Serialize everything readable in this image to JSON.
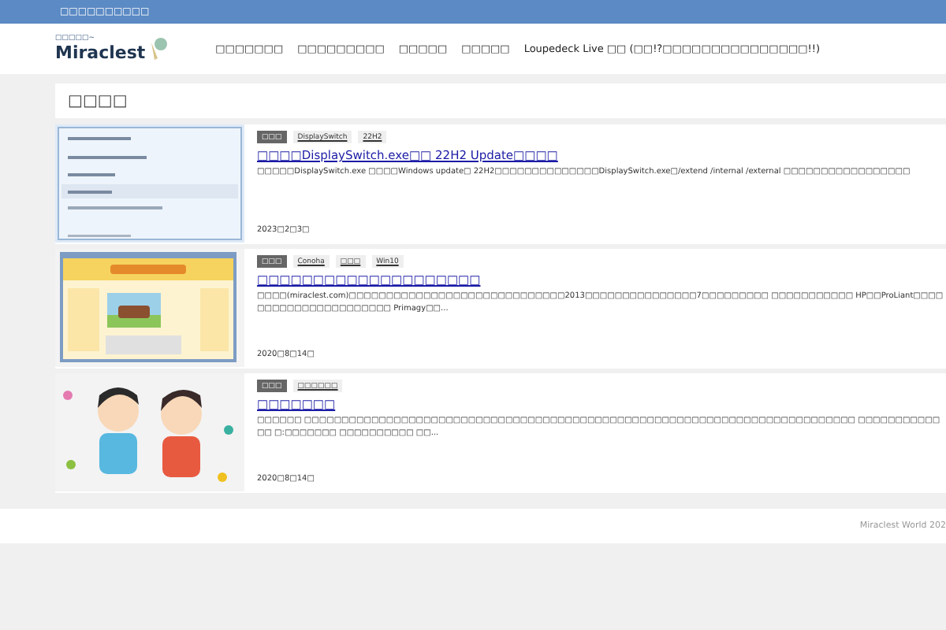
{
  "top_bar": {
    "text": "□□□□□□□□□□"
  },
  "logo": {
    "tagline": "□□□□□~",
    "name": "Miraclest"
  },
  "nav": [
    "□□□□□□□",
    "□□□□□□□□□",
    "□□□□□",
    "□□□□□",
    "Loupedeck Live □□ (□□!?□□□□□□□□□□□□□□□!!)"
  ],
  "section_title": "□□□□",
  "posts": [
    {
      "thumbnail": {
        "kind": "picture"
      },
      "tags": [
        {
          "label": "□□□",
          "kind": "category"
        },
        {
          "label": "DisplaySwitch",
          "kind": "tag"
        },
        {
          "label": "22H2",
          "kind": "tag"
        }
      ],
      "title": "□□□□DisplaySwitch.exe□□ 22H2 Update□□□□",
      "excerpt": "□□□□□DisplaySwitch.exe □□□□Windows update□ 22H2□□□□□□□□□□□□□□DisplaySwitch.exe□/extend /internal /external □□□□□□□□□□□□□□□□□",
      "date": "2023□2□3□"
    },
    {
      "thumbnail": {
        "kind": "picture"
      },
      "tags": [
        {
          "label": "□□□",
          "kind": "category"
        },
        {
          "label": "Conoha",
          "kind": "tag"
        },
        {
          "label": "□□□",
          "kind": "tag"
        },
        {
          "label": "Win10",
          "kind": "tag"
        }
      ],
      "title": "□□□□□□□□□□□□□□□□□□□□",
      "excerpt": "□□□□(miraclest.com)□□□□□□□□□□□□□□□□□□□□□□□□□□□□□2013□□□□□□□□□□□□□□□7□□□□□□□□□ □□□□□□□□□□□ HP□□ProLiant□□□□□□□□□□□□□□□□□□□□□□ Primagy□□...",
      "date": "2020□8□14□"
    },
    {
      "thumbnail": {
        "kind": "picture"
      },
      "tags": [
        {
          "label": "□□□",
          "kind": "category"
        },
        {
          "label": "□□□□□□",
          "kind": "tag"
        }
      ],
      "title": "□□□□□□□",
      "excerpt": "□□□□□□ □□□□□□□□□□□□□□□□□□□□□□□□□□□□□□□□□□□□□□□□□□□□□□□□□□□□□□□□□□□□□□□□□□□□□□□□□□ □□□□□□□□□□□□□ □:□□□□□□□ □□□□□□□□□□ □□...",
      "date": "2020□8□14□"
    }
  ],
  "footer": "Miraclest World 202"
}
